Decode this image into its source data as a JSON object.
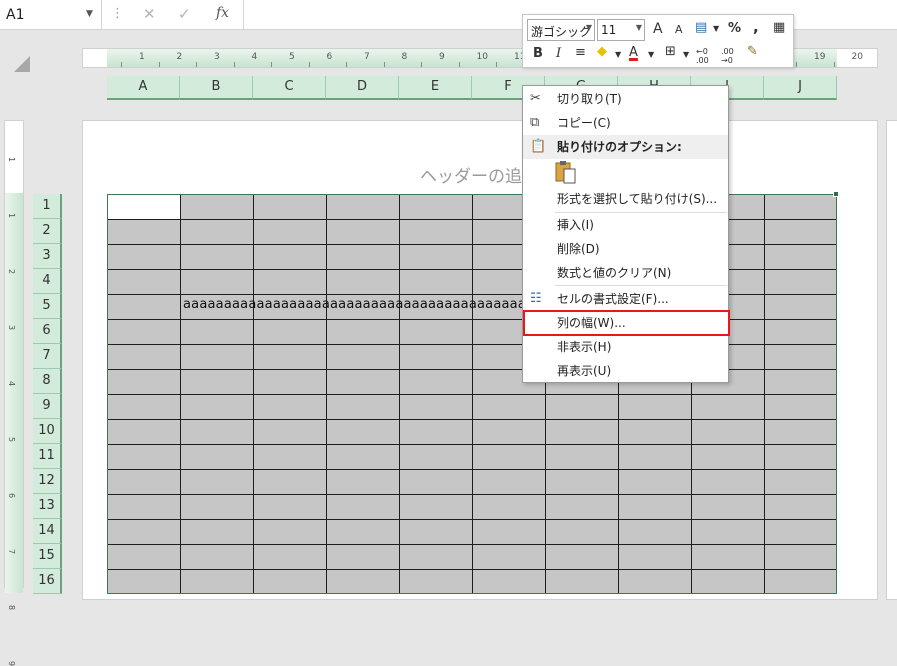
{
  "formula_bar": {
    "name_box": "A1",
    "cancel_icon": "✕",
    "enter_icon": "✓",
    "fx_label": "fx"
  },
  "header_placeholder": "ヘッダーの追",
  "ruler": {
    "numbers": [
      "1",
      "2",
      "3",
      "4",
      "5",
      "6",
      "7",
      "8",
      "9",
      "10",
      "11",
      "12",
      "13",
      "14",
      "15",
      "16",
      "17",
      "18",
      "19",
      "20"
    ]
  },
  "vruler": {
    "numbers": [
      "1",
      "1",
      "2",
      "3",
      "4",
      "5",
      "6",
      "7",
      "8",
      "9"
    ]
  },
  "columns": [
    "A",
    "B",
    "C",
    "D",
    "E",
    "F",
    "G",
    "H",
    "I",
    "J"
  ],
  "rows": [
    "1",
    "2",
    "3",
    "4",
    "5",
    "6",
    "7",
    "8",
    "9",
    "10",
    "11",
    "12",
    "13",
    "14",
    "15",
    "16"
  ],
  "cell_content": {
    "row": 5,
    "text": "aaaaaaaaaaaaaaaaaaaaaaaaaaaaaaaaaaaaaaaaaaaaaaaa"
  },
  "mini_toolbar": {
    "font_name": "游ゴシック",
    "font_size": "11",
    "grow_font": "A",
    "shrink_font": "A",
    "percent": "%",
    "comma": ",",
    "bold": "B",
    "italic": "I",
    "font_color": "A",
    "inc_decimal": "←0 .00",
    "dec_decimal": ".00 →0"
  },
  "context_menu": {
    "cut": "切り取り(T)",
    "copy": "コピー(C)",
    "paste_options": "貼り付けのオプション:",
    "paste_special": "形式を選択して貼り付け(S)...",
    "insert": "挿入(I)",
    "delete": "削除(D)",
    "clear": "数式と値のクリア(N)",
    "format_cells": "セルの書式設定(F)...",
    "column_width": "列の幅(W)...",
    "hide": "非表示(H)",
    "unhide": "再表示(U)"
  },
  "colors": {
    "header_green": "#d3ebdb",
    "grid_border": "#3c7a52",
    "highlight_red": "#e81818",
    "cell_gray": "#c6c6c6"
  }
}
